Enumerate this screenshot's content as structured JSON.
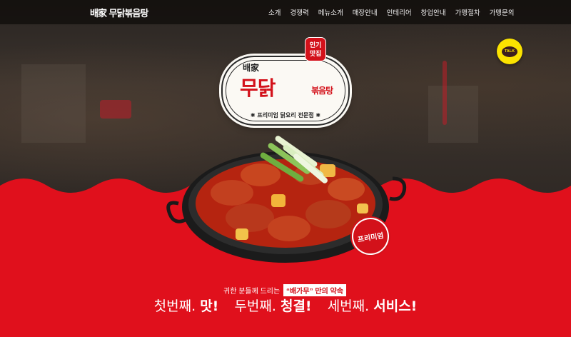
{
  "nav": {
    "logo_text": "배家 무닭볶음탕",
    "items": [
      "소개",
      "경쟁력",
      "메뉴소개",
      "매장안내",
      "인테리어",
      "창업안내",
      "가맹절차",
      "가맹문의"
    ]
  },
  "hero": {
    "logo": {
      "top_text": "배家",
      "main_text": "무닭",
      "sub_text": "볶음탕",
      "tagline": "✱ 프리미엄 닭요리 전문점 ✱"
    },
    "popular_badge": "인기\n맛집",
    "premium_sticker": "프리미엄",
    "talk_label": "TALK"
  },
  "promo": {
    "prefix": "귀한 분들께 드리는",
    "brand": "“배가무” 만의 약속",
    "slogan": [
      {
        "thin": "첫번째.",
        "bold": "맛!"
      },
      {
        "thin": "두번째.",
        "bold": "청결!"
      },
      {
        "thin": "세번째.",
        "bold": "서비스!"
      }
    ]
  },
  "colors": {
    "brand_red": "#e0101c",
    "kakao_yellow": "#fbe300",
    "nav_bg": "#0f0c0a"
  }
}
